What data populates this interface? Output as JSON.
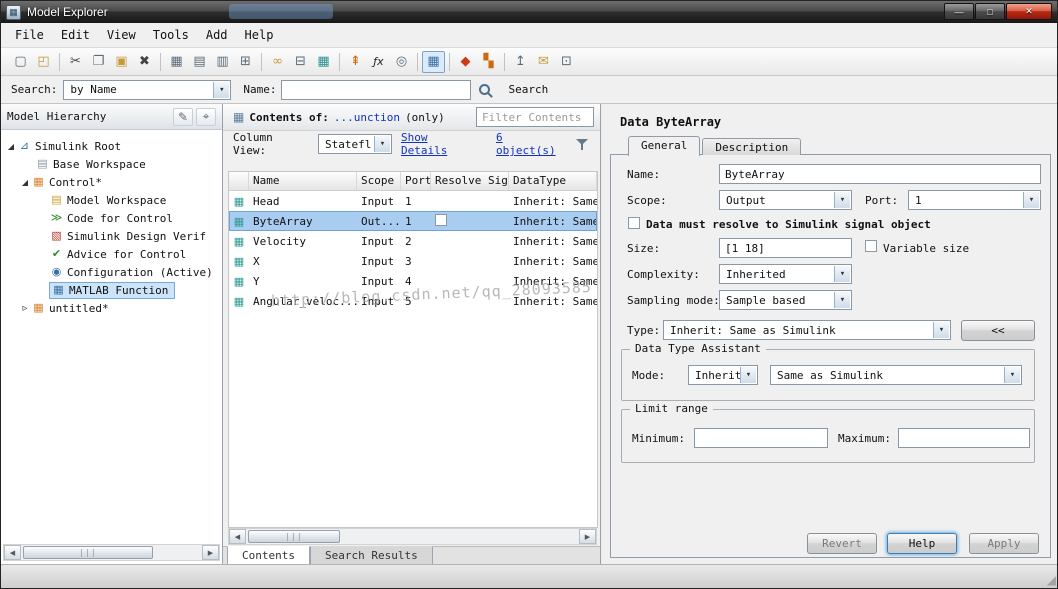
{
  "window": {
    "title": "Model Explorer",
    "controls": {
      "minimize": "—",
      "maximize": "□",
      "close": "✕"
    }
  },
  "menubar": {
    "items": [
      "File",
      "Edit",
      "View",
      "Tools",
      "Add",
      "Help"
    ]
  },
  "toolbar": {
    "icons": [
      {
        "name": "new-model-icon",
        "glyph": "▢"
      },
      {
        "name": "open-model-icon",
        "glyph": "◰"
      },
      {
        "name": "cut-icon",
        "glyph": "✂"
      },
      {
        "name": "copy-icon",
        "glyph": "❐"
      },
      {
        "name": "paste-icon",
        "glyph": "▣"
      },
      {
        "name": "delete-icon",
        "glyph": "✖"
      },
      {
        "name": "expand-all-icon",
        "glyph": "▦"
      },
      {
        "name": "collapse-all-icon",
        "glyph": "▤"
      },
      {
        "name": "show-library-icon",
        "glyph": "▥"
      },
      {
        "name": "layout-icon",
        "glyph": "⊞"
      },
      {
        "name": "link-icon",
        "glyph": "∞"
      },
      {
        "name": "unlink-icon",
        "glyph": "⊟"
      },
      {
        "name": "data-view-icon",
        "glyph": "▦"
      },
      {
        "name": "import-signal-icon",
        "glyph": "⇞"
      },
      {
        "name": "function-icon",
        "glyph": "ƒx"
      },
      {
        "name": "scope-icon",
        "glyph": "◎"
      },
      {
        "name": "table-view-icon",
        "glyph": "▦"
      },
      {
        "name": "simulink-library-icon",
        "glyph": "◆"
      },
      {
        "name": "stateflow-icon",
        "glyph": "▚"
      },
      {
        "name": "export-icon",
        "glyph": "↥"
      },
      {
        "name": "mail-icon",
        "glyph": "✉"
      },
      {
        "name": "print-icon",
        "glyph": "⊡"
      }
    ]
  },
  "searchbar": {
    "search_label": "Search:",
    "search_type_value": "by Name",
    "name_label": "Name:",
    "name_value": "",
    "search_button_label": "Search"
  },
  "hierarchy": {
    "title": "Model Hierarchy",
    "items": [
      {
        "label": "Simulink Root",
        "glyph": "⊿"
      },
      {
        "label": "Base Workspace",
        "glyph": "▤"
      },
      {
        "label": "Control*",
        "glyph": "▦"
      },
      {
        "label": "Model Workspace",
        "glyph": "▤"
      },
      {
        "label": "Code for Control",
        "glyph": "≫"
      },
      {
        "label": "Simulink Design Verif",
        "glyph": "▧"
      },
      {
        "label": "Advice for Control",
        "glyph": "✔"
      },
      {
        "label": "Configuration (Active)",
        "glyph": "◉"
      },
      {
        "label": "MATLAB Function",
        "glyph": "▦"
      },
      {
        "label": "untitled*",
        "glyph": "▦"
      }
    ]
  },
  "contents": {
    "panel_icon": "▦",
    "header_label": "Contents of:",
    "header_link": "...unction",
    "header_suffix": "(only)",
    "filter_placeholder": "Filter Contents",
    "column_view_label": "Column View:",
    "column_view_value": "Statefl",
    "show_details_link": "Show Details",
    "objects_link": "6 object(s)",
    "row_icon": "▦",
    "table": {
      "headers": [
        "Name",
        "Scope",
        "Port",
        "Resolve Signal",
        "DataType"
      ],
      "rows": [
        {
          "name": "Head",
          "scope": "Input",
          "port": "1",
          "datatype": "Inherit: Same"
        },
        {
          "name": "ByteArray",
          "scope": "Out...",
          "port": "1",
          "datatype": "Inherit: Same"
        },
        {
          "name": "Velocity",
          "scope": "Input",
          "port": "2",
          "datatype": "Inherit: Same"
        },
        {
          "name": "X",
          "scope": "Input",
          "port": "3",
          "datatype": "Inherit: Same"
        },
        {
          "name": "Y",
          "scope": "Input",
          "port": "4",
          "datatype": "Inherit: Same"
        },
        {
          "name": "Angular_veloc...",
          "scope": "Input",
          "port": "5",
          "datatype": "Inherit: Same"
        }
      ]
    },
    "tabs": [
      "Contents",
      "Search Results"
    ]
  },
  "details": {
    "title": "Data ByteArray",
    "tabs": [
      "General",
      "Description"
    ],
    "name_label": "Name:",
    "name_value": "ByteArray",
    "scope_label": "Scope:",
    "scope_value": "Output",
    "port_label": "Port:",
    "port_value": "1",
    "resolve_checkbox_label": "Data must resolve to Simulink signal object",
    "size_label": "Size:",
    "size_value": "[1 18]",
    "variable_size_label": "Variable size",
    "complexity_label": "Complexity:",
    "complexity_value": "Inherited",
    "sampling_label": "Sampling mode:",
    "sampling_value": "Sample based",
    "type_label": "Type:",
    "type_value": "Inherit: Same as Simulink",
    "collapse_button_label": "<<",
    "dta": {
      "title": "Data Type Assistant",
      "mode_label": "Mode:",
      "mode_value": "Inherit",
      "type_value": "Same as Simulink"
    },
    "limit": {
      "title": "Limit range",
      "min_label": "Minimum:",
      "min_value": "",
      "max_label": "Maximum:",
      "max_value": ""
    },
    "buttons": {
      "revert": "Revert",
      "help": "Help",
      "apply": "Apply"
    }
  },
  "watermark": "http://blog.csdn.net/qq_28093585"
}
